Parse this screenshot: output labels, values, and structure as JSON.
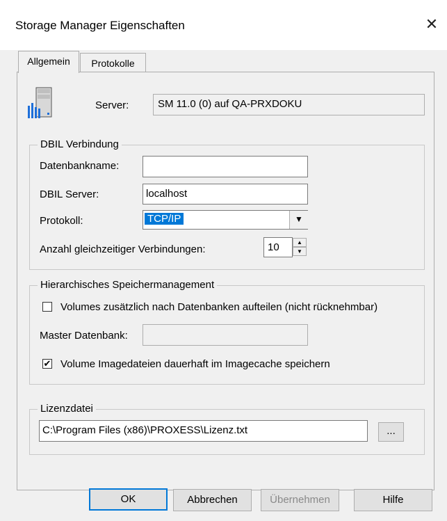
{
  "window": {
    "title": "Storage Manager Eigenschaften",
    "close_glyph": "✕"
  },
  "tabs": [
    {
      "label": "Allgemein"
    },
    {
      "label": "Protokolle"
    }
  ],
  "server": {
    "label": "Server:",
    "value": "SM 11.0 (0) auf QA-PRXDOKU"
  },
  "dbil": {
    "group_label": "DBIL Verbindung",
    "database_name_label": "Datenbankname:",
    "database_name_value": "",
    "server_label": "DBIL Server:",
    "server_value": "localhost",
    "protocol_label": "Protokoll:",
    "protocol_value": "TCP/IP",
    "connections_label": "Anzahl gleichzeitiger Verbindungen:",
    "connections_value": "10"
  },
  "hsm": {
    "group_label": "Hierarchisches Speichermanagement",
    "split_volumes_label": "Volumes zusätzlich nach Datenbanken aufteilen (nicht rücknehmbar)",
    "split_volumes_checked": false,
    "master_db_label": "Master Datenbank:",
    "master_db_value": "",
    "store_images_label": "Volume Imagedateien dauerhaft im Imagecache speichern",
    "store_images_checked": true
  },
  "license": {
    "group_label": "Lizenzdatei",
    "path_value": "C:\\Program Files (x86)\\PROXESS\\Lizenz.txt",
    "browse_label": "..."
  },
  "buttons": {
    "ok": "OK",
    "cancel": "Abbrechen",
    "apply": "Übernehmen",
    "help": "Hilfe"
  }
}
